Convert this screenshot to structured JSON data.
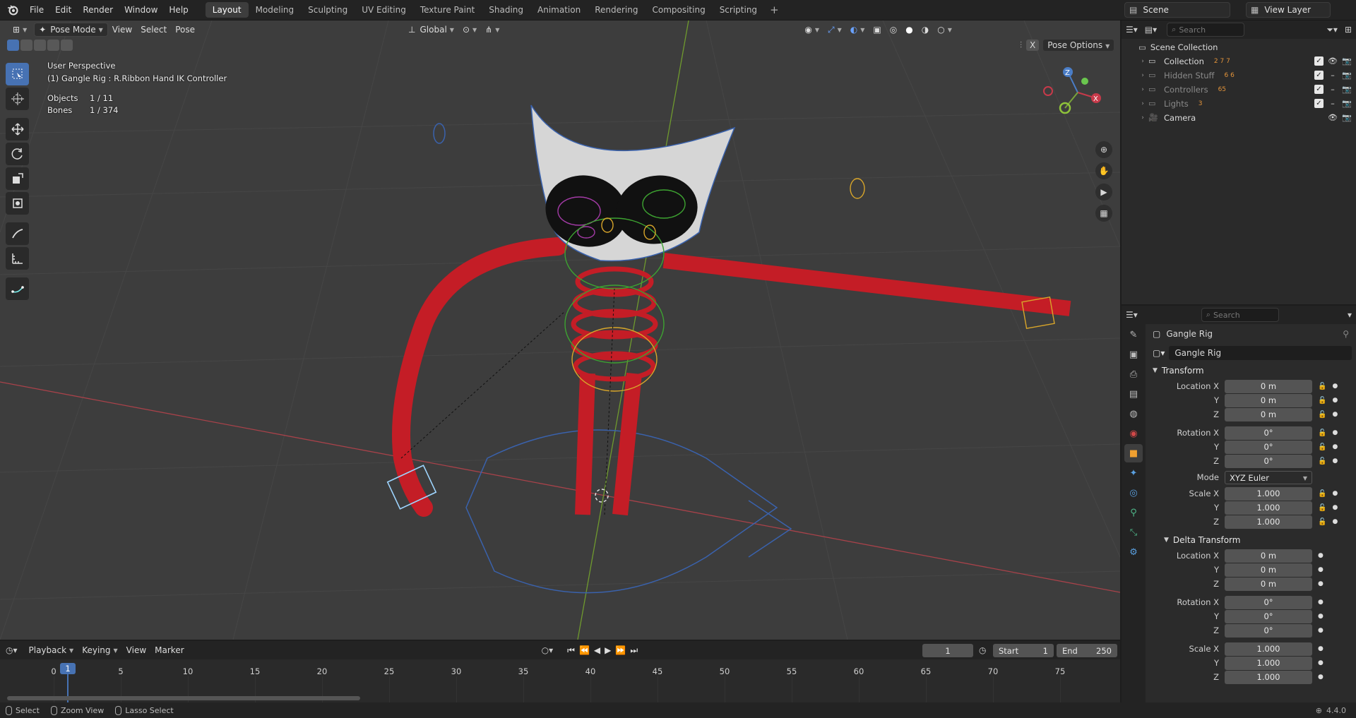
{
  "menu": [
    "File",
    "Edit",
    "Render",
    "Window",
    "Help"
  ],
  "workspaces": [
    "Layout",
    "Modeling",
    "Sculpting",
    "UV Editing",
    "Texture Paint",
    "Shading",
    "Animation",
    "Rendering",
    "Compositing",
    "Scripting"
  ],
  "active_workspace": "Layout",
  "add_workspace": "+",
  "scene": "Scene",
  "view_layer": "View Layer",
  "viewport": {
    "mode": "Pose Mode",
    "menus": [
      "View",
      "Select",
      "Pose"
    ],
    "orientation": "Global",
    "pose_options": "Pose Options",
    "x_mirror": "X",
    "perspective": "User Perspective",
    "active": "(1) Gangle Rig : R.Ribbon Hand IK Controller",
    "stats": [
      {
        "label": "Objects",
        "value": "1 / 11"
      },
      {
        "label": "Bones",
        "value": "1 / 374"
      }
    ]
  },
  "outliner": {
    "search_placeholder": "Search",
    "root": "Scene Collection",
    "items": [
      {
        "label": "Collection",
        "dim": false,
        "badge": "2 7 7"
      },
      {
        "label": "Hidden Stuff",
        "dim": true,
        "badge": "6 6"
      },
      {
        "label": "Controllers",
        "dim": true,
        "badge": "65"
      },
      {
        "label": "Lights",
        "dim": true,
        "badge": "3"
      },
      {
        "label": "Camera",
        "dim": false,
        "badge": ""
      }
    ]
  },
  "properties": {
    "search_placeholder": "Search",
    "object_name": "Gangle Rig",
    "data_name": "Gangle Rig",
    "transform": {
      "title": "Transform",
      "location": [
        {
          "label": "Location X",
          "value": "0 m"
        },
        {
          "label": "Y",
          "value": "0 m"
        },
        {
          "label": "Z",
          "value": "0 m"
        }
      ],
      "rotation": [
        {
          "label": "Rotation X",
          "value": "0°"
        },
        {
          "label": "Y",
          "value": "0°"
        },
        {
          "label": "Z",
          "value": "0°"
        }
      ],
      "mode_label": "Mode",
      "mode_value": "XYZ Euler",
      "scale": [
        {
          "label": "Scale X",
          "value": "1.000"
        },
        {
          "label": "Y",
          "value": "1.000"
        },
        {
          "label": "Z",
          "value": "1.000"
        }
      ]
    },
    "delta": {
      "title": "Delta Transform",
      "location": [
        {
          "label": "Location X",
          "value": "0 m"
        },
        {
          "label": "Y",
          "value": "0 m"
        },
        {
          "label": "Z",
          "value": "0 m"
        }
      ],
      "rotation": [
        {
          "label": "Rotation X",
          "value": "0°"
        },
        {
          "label": "Y",
          "value": "0°"
        },
        {
          "label": "Z",
          "value": "0°"
        }
      ],
      "scale": [
        {
          "label": "Scale X",
          "value": "1.000"
        },
        {
          "label": "Y",
          "value": "1.000"
        },
        {
          "label": "Z",
          "value": "1.000"
        }
      ]
    }
  },
  "timeline": {
    "menus": [
      "Playback",
      "Keying",
      "View",
      "Marker"
    ],
    "current_frame": "1",
    "start_label": "Start",
    "start": "1",
    "end_label": "End",
    "end": "250",
    "ticks": [
      "0",
      "5",
      "10",
      "15",
      "20",
      "25",
      "30",
      "35",
      "40",
      "45",
      "50",
      "55",
      "60",
      "65",
      "70",
      "75"
    ],
    "playhead": "1"
  },
  "status": {
    "items": [
      "Select",
      "Zoom View",
      "Lasso Select"
    ],
    "version": "4.4.0"
  }
}
